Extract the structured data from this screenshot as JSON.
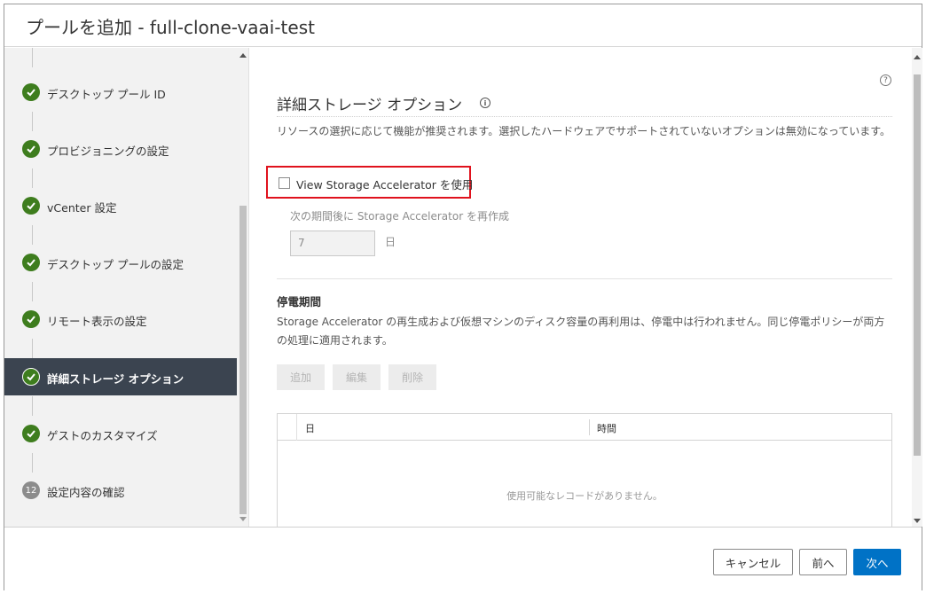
{
  "window": {
    "title": "プールを追加 - full-clone-vaai-test"
  },
  "sidebar": {
    "steps": [
      {
        "label": "デスクトップ プール ID",
        "status": "done"
      },
      {
        "label": "プロビジョニングの設定",
        "status": "done"
      },
      {
        "label": "vCenter 設定",
        "status": "done"
      },
      {
        "label": "デスクトップ プールの設定",
        "status": "done"
      },
      {
        "label": "リモート表示の設定",
        "status": "done"
      },
      {
        "label": "詳細ストレージ オプション",
        "status": "active"
      },
      {
        "label": "ゲストのカスタマイズ",
        "status": "done"
      },
      {
        "label": "設定内容の確認",
        "status": "pending",
        "number": "12"
      }
    ]
  },
  "main": {
    "help_symbol": "?",
    "section_title": "詳細ストレージ オプション",
    "info_symbol": "i",
    "description": "リソースの選択に応じて機能が推奨されます。選択したハードウェアでサポートされていないオプションは無効になっています。",
    "accelerator_checkbox_label": "View Storage Accelerator を使用",
    "regenerate_label": "次の期間後に Storage Accelerator を再作成",
    "regenerate_value": "7",
    "regenerate_unit": "日",
    "blackout_title": "停電期間",
    "blackout_description": "Storage Accelerator の再生成および仮想マシンのディスク容量の再利用は、停電中は行われません。同じ停電ポリシーが両方の処理に適用されます。",
    "buttons": {
      "add": "追加",
      "edit": "編集",
      "delete": "削除"
    },
    "grid": {
      "columns": [
        "日",
        "時間"
      ],
      "empty_message": "使用可能なレコードがありません。"
    }
  },
  "footer": {
    "cancel": "キャンセル",
    "back": "前へ",
    "next": "次へ"
  },
  "colors": {
    "accent": "#0072c6",
    "check_green": "#3e7d1e",
    "active_step_bg": "#3b4450",
    "highlight_red": "#e0121d"
  }
}
